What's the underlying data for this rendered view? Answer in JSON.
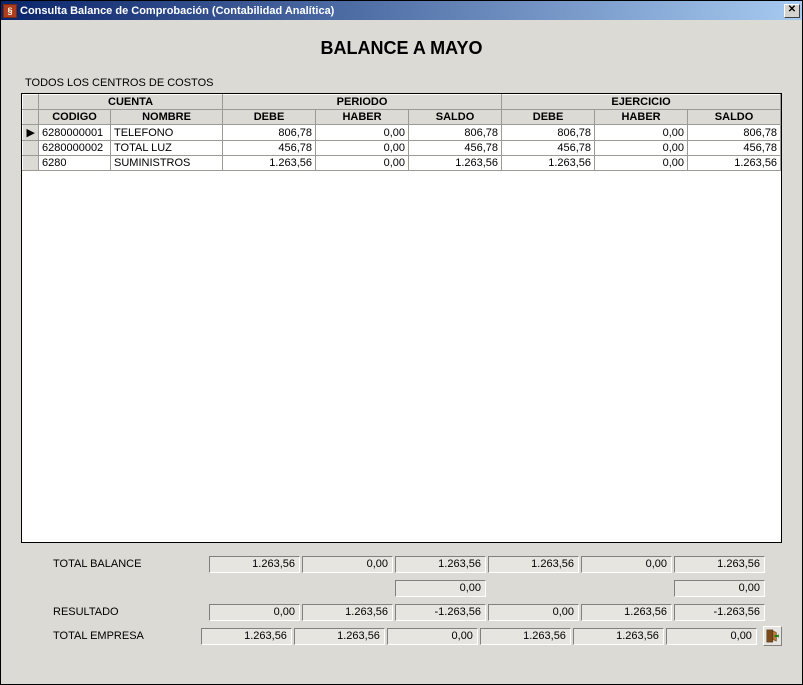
{
  "window": {
    "title": "Consulta Balance de Comprobación (Contabilidad Analítica)"
  },
  "main_title": "BALANCE A MAYO",
  "subtitle": "TODOS LOS CENTROS DE COSTOS",
  "grid": {
    "group_headers": {
      "cuenta": "CUENTA",
      "periodo": "PERIODO",
      "ejercicio": "EJERCICIO"
    },
    "headers": {
      "codigo": "CODIGO",
      "nombre": "NOMBRE",
      "p_debe": "DEBE",
      "p_haber": "HABER",
      "p_saldo": "SALDO",
      "e_debe": "DEBE",
      "e_haber": "HABER",
      "e_saldo": "SALDO"
    },
    "rows": [
      {
        "indicator": "▶",
        "codigo": "6280000001",
        "nombre": "TELEFONO",
        "p_debe": "806,78",
        "p_haber": "0,00",
        "p_saldo": "806,78",
        "e_debe": "806,78",
        "e_haber": "0,00",
        "e_saldo": "806,78"
      },
      {
        "indicator": "",
        "codigo": "6280000002",
        "nombre": "TOTAL LUZ",
        "p_debe": "456,78",
        "p_haber": "0,00",
        "p_saldo": "456,78",
        "e_debe": "456,78",
        "e_haber": "0,00",
        "e_saldo": "456,78"
      },
      {
        "indicator": "",
        "codigo": "6280",
        "nombre": "SUMINISTROS",
        "p_debe": "1.263,56",
        "p_haber": "0,00",
        "p_saldo": "1.263,56",
        "e_debe": "1.263,56",
        "e_haber": "0,00",
        "e_saldo": "1.263,56"
      }
    ]
  },
  "totals": {
    "balance_label": "TOTAL BALANCE",
    "balance": [
      "1.263,56",
      "0,00",
      "1.263,56",
      "1.263,56",
      "0,00",
      "1.263,56"
    ],
    "extra": [
      "0,00",
      "0,00"
    ],
    "resultado_label": "RESULTADO",
    "resultado": [
      "0,00",
      "1.263,56",
      "-1.263,56",
      "0,00",
      "1.263,56",
      "-1.263,56"
    ],
    "empresa_label": "TOTAL EMPRESA",
    "empresa": [
      "1.263,56",
      "1.263,56",
      "0,00",
      "1.263,56",
      "1.263,56",
      "0,00"
    ]
  }
}
